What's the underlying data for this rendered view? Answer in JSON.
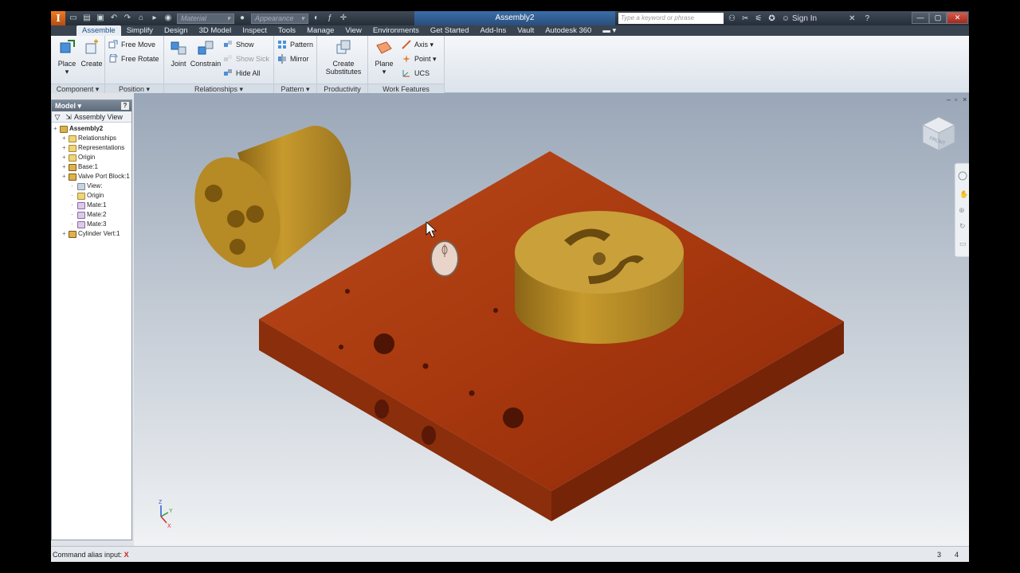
{
  "titlebar": {
    "app_logo": "I",
    "material_placeholder": "Material",
    "appearance_placeholder": "Appearance",
    "document_title": "Assembly2",
    "search_placeholder": "Type a keyword or phrase",
    "sign_in": "Sign In"
  },
  "tabs": [
    "Assemble",
    "Simplify",
    "Design",
    "3D Model",
    "Inspect",
    "Tools",
    "Manage",
    "View",
    "Environments",
    "Get Started",
    "Add-Ins",
    "Vault",
    "Autodesk 360"
  ],
  "ribbon": {
    "component": {
      "title": "Component",
      "place": "Place",
      "create": "Create"
    },
    "position": {
      "title": "Position",
      "free_move": "Free Move",
      "free_rotate": "Free Rotate"
    },
    "relationships": {
      "title": "Relationships",
      "joint": "Joint",
      "constrain": "Constrain",
      "show": "Show",
      "show_sick": "Show Sick",
      "hide_all": "Hide All"
    },
    "pattern": {
      "title": "Pattern",
      "pattern": "Pattern",
      "mirror": "Mirror"
    },
    "productivity": {
      "title": "Productivity",
      "create_substitutes_1": "Create",
      "create_substitutes_2": "Substitutes"
    },
    "work_features": {
      "title": "Work Features",
      "plane": "Plane",
      "axis": "Axis",
      "point": "Point",
      "ucs": "UCS"
    }
  },
  "browser": {
    "title": "Model",
    "view_label": "Assembly View",
    "tree": [
      {
        "label": "Assembly2",
        "level": 0,
        "icon": "asm",
        "bold": true
      },
      {
        "label": "Relationships",
        "level": 1,
        "icon": "folder"
      },
      {
        "label": "Representations",
        "level": 1,
        "icon": "folder"
      },
      {
        "label": "Origin",
        "level": 1,
        "icon": "folder"
      },
      {
        "label": "Base:1",
        "level": 1,
        "icon": "part"
      },
      {
        "label": "Valve Port Block:1",
        "level": 1,
        "icon": "part"
      },
      {
        "label": "View:",
        "level": 2,
        "icon": "view"
      },
      {
        "label": "Origin",
        "level": 2,
        "icon": "folder"
      },
      {
        "label": "Mate:1",
        "level": 2,
        "icon": "mate"
      },
      {
        "label": "Mate:2",
        "level": 2,
        "icon": "mate"
      },
      {
        "label": "Mate:3",
        "level": 2,
        "icon": "mate"
      },
      {
        "label": "Cylinder Vert:1",
        "level": 1,
        "icon": "part"
      }
    ]
  },
  "status": {
    "command_label": "Command alias input:",
    "command_x": "X",
    "count_a": "3",
    "count_b": "4"
  },
  "triad": {
    "z": "Z",
    "y": "Y",
    "x": "X"
  },
  "viewcube": {
    "label": "FRONT"
  }
}
